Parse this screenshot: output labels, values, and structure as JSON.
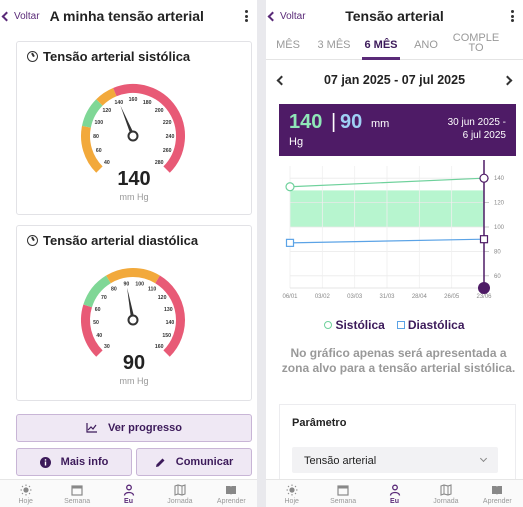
{
  "left": {
    "back_label": "Voltar",
    "title": "A minha tensão arterial",
    "systolic": {
      "title": "Tensão arterial sistólica",
      "value": "140",
      "unit": "mm Hg",
      "ticks": [
        "40",
        "60",
        "80",
        "100",
        "120",
        "140",
        "160",
        "180",
        "200",
        "220",
        "240",
        "260",
        "280"
      ]
    },
    "diastolic": {
      "title": "Tensão arterial diastólica",
      "value": "90",
      "unit": "mm Hg",
      "ticks": [
        "30",
        "40",
        "50",
        "60",
        "70",
        "80",
        "90",
        "100",
        "110",
        "120",
        "130",
        "140",
        "150",
        "160"
      ]
    },
    "buttons": {
      "progress": "Ver progresso",
      "info": "Mais info",
      "communicate": "Comunicar"
    }
  },
  "right": {
    "back_label": "Voltar",
    "title": "Tensão arterial",
    "periods": [
      "MÊS",
      "3 MÊS",
      "6 MÊS",
      "ANO",
      "COMPLE TO"
    ],
    "range": "07 jan 2025 - 07 jul 2025",
    "reading": {
      "systolic": "140",
      "separator": "|",
      "diastolic": "90",
      "unit_a": "mm",
      "unit_b": "Hg",
      "date_line1": "30 jun 2025 -",
      "date_line2": "6 jul 2025"
    },
    "legend": {
      "systolic": "Sistólica",
      "diastolic": "Diastólica"
    },
    "note": "No gráfico apenas será apresentada a zona alvo para a tensão arterial sistólica.",
    "parameter": {
      "title": "Parâmetro",
      "value": "Tensão arterial"
    }
  },
  "tabbar": {
    "items": [
      {
        "label": "Hoje",
        "icon": "sun-icon"
      },
      {
        "label": "Semana",
        "icon": "calendar-icon"
      },
      {
        "label": "Eu",
        "icon": "person-icon"
      },
      {
        "label": "Jornada",
        "icon": "map-icon"
      },
      {
        "label": "Aprender",
        "icon": "book-icon"
      }
    ],
    "active": 2
  },
  "colors": {
    "accent": "#5a2a78",
    "header_band": "#4e1b66",
    "systolic": "#6fd19c",
    "diastolic": "#5ba3e6",
    "target_zone": "#b7f5cf",
    "gauge_low": "#e85a76",
    "gauge_mid": "#f2a93b",
    "gauge_ok": "#7fd796"
  },
  "chart_data": {
    "type": "line",
    "x": [
      "06/01",
      "03/02",
      "03/03",
      "31/03",
      "28/04",
      "26/05",
      "23/06"
    ],
    "yticks": [
      60,
      80,
      100,
      120,
      140
    ],
    "ylim": [
      50,
      150
    ],
    "target_zone": [
      100,
      130
    ],
    "series": [
      {
        "name": "Sistólica",
        "points": [
          {
            "x": "06/01",
            "y": 133
          },
          {
            "x": "23/06",
            "y": 140
          }
        ]
      },
      {
        "name": "Diastólica",
        "points": [
          {
            "x": "06/01",
            "y": 87
          },
          {
            "x": "23/06",
            "y": 90
          }
        ]
      }
    ],
    "selected_x": "23/06"
  }
}
